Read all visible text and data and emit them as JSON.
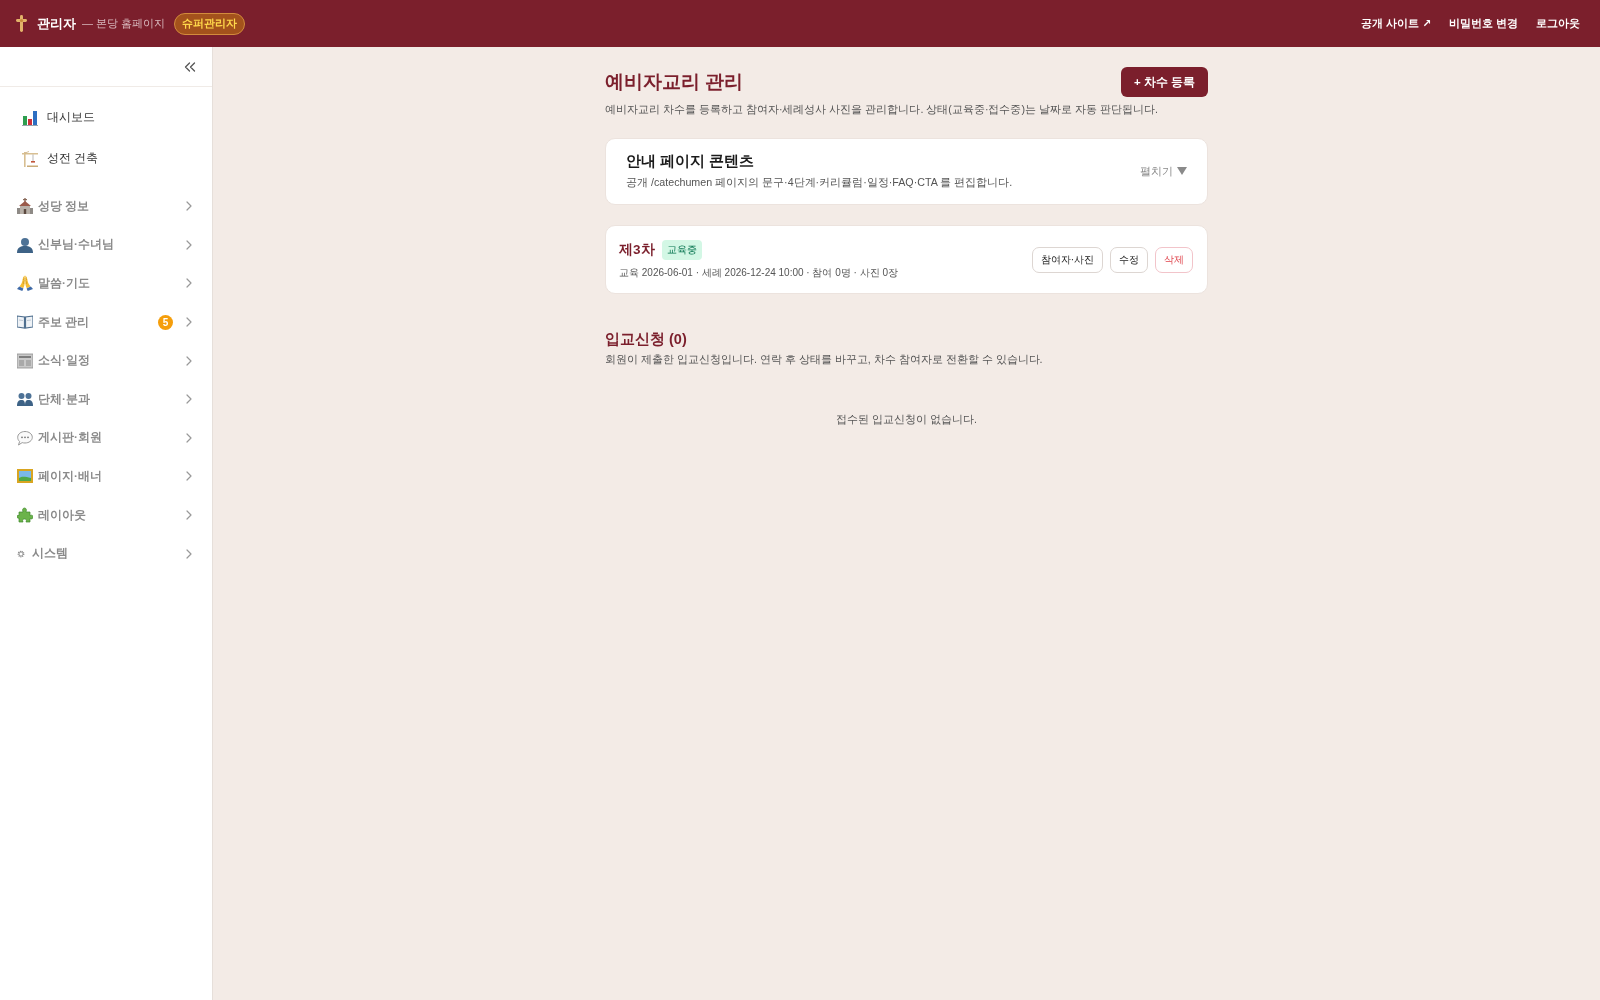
{
  "header": {
    "title": "관리자",
    "subtitle": "— 본당 홈페이지",
    "role_badge": "슈퍼관리자",
    "links": [
      {
        "label": "공개 사이트 ↗"
      },
      {
        "label": "비밀번호 변경"
      },
      {
        "label": "로그아웃"
      }
    ]
  },
  "sidebar": {
    "items": [
      {
        "kind": "link",
        "label": "대시보드",
        "selected": false
      },
      {
        "kind": "link",
        "label": "성전 건축",
        "selected": false
      },
      {
        "kind": "group",
        "label": "성당 정보",
        "selected": false,
        "expanded": false
      },
      {
        "kind": "group",
        "label": "신부님·수녀님",
        "selected": false,
        "expanded": false
      },
      {
        "kind": "group",
        "label": "말씀·기도",
        "selected": false,
        "expanded": false
      },
      {
        "kind": "group",
        "label": "주보 관리",
        "selected": false,
        "expanded": false,
        "badge": "5"
      },
      {
        "kind": "group",
        "label": "소식·일정",
        "selected": false,
        "expanded": false
      },
      {
        "kind": "group",
        "label": "단체·분과",
        "selected": false,
        "expanded": false
      },
      {
        "kind": "group",
        "label": "게시판·회원",
        "selected": false,
        "expanded": false
      },
      {
        "kind": "group",
        "label": "페이지·배너",
        "selected": false,
        "expanded": false
      },
      {
        "kind": "group",
        "label": "레이아웃",
        "selected": false,
        "expanded": false
      },
      {
        "kind": "group",
        "label": "시스템",
        "selected": false,
        "expanded": false
      }
    ]
  },
  "page": {
    "title": "예비자교리 관리",
    "description": "예비자교리 차수를 등록하고 참여자·세례성사 사진을 관리합니다. 상태(교육중·접수중)는 날짜로 자동 판단됩니다.",
    "primary_button": "+ 차수 등록"
  },
  "content_panel": {
    "title": "안내 페이지 콘텐츠",
    "description": "공개 /catechumen 페이지의 문구·4단계·커리큘럼·일정·FAQ·CTA 를 편집합니다.",
    "toggle": "펼치기",
    "expanded": false
  },
  "cohorts": [
    {
      "title": "제3차",
      "status": "교육중",
      "meta": "교육 2026-06-01 · 세례 2026-12-24 10:00 · 참여 0명 · 사진 0장",
      "actions": [
        {
          "label": "참여자·사진",
          "kind": "default"
        },
        {
          "label": "수정",
          "kind": "default"
        },
        {
          "label": "삭제",
          "kind": "danger"
        }
      ]
    }
  ],
  "applications": {
    "title": "입교신청 (0)",
    "description": "회원이 제출한 입교신청입니다. 연락 후 상태를 바꾸고, 차수 참여자로 전환할 수 있습니다.",
    "empty_message": "접수된 입교신청이 없습니다."
  }
}
